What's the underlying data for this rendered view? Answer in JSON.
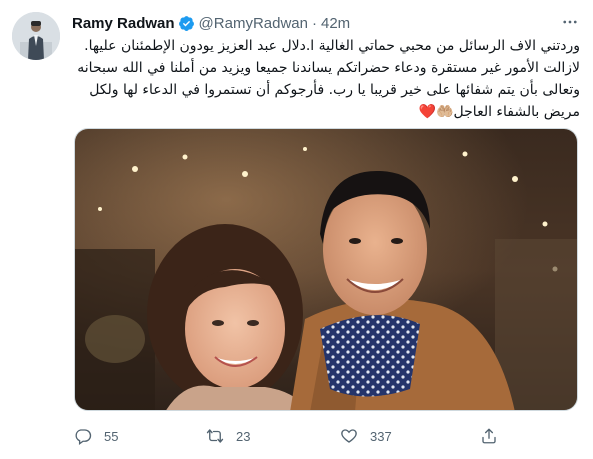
{
  "tweet": {
    "author_name": "Ramy Radwan",
    "handle": "@RamyRadwan",
    "separator": "·",
    "time": "42m",
    "text": "وردتني الاف الرسائل من محبي حماتي الغالية ا.دلال عبد العزيز يودون الإطمئنان عليها. لازالت الأمور غير مستقرة ودعاء حضراتكم يساندنا جميعا ويزيد من أملنا في الله سبحانه وتعالى بأن يتم شفائها على خير قريبا يا رب. فأرجوكم أن تستمروا في الدعاء لها ولكل مريض بالشفاء العاجل",
    "text_emoji": "🤲🏼❤️"
  },
  "actions": {
    "reply_count": "55",
    "retweet_count": "23",
    "like_count": "337"
  },
  "icons": {
    "verified": "verified-badge-icon",
    "more": "more-options-icon",
    "reply": "reply-icon",
    "retweet": "retweet-icon",
    "like": "heart-icon",
    "share": "share-icon"
  },
  "colors": {
    "verified": "#1d9bf0",
    "text": "#0f1419",
    "secondary": "#536471",
    "heart": "#e0245e"
  }
}
